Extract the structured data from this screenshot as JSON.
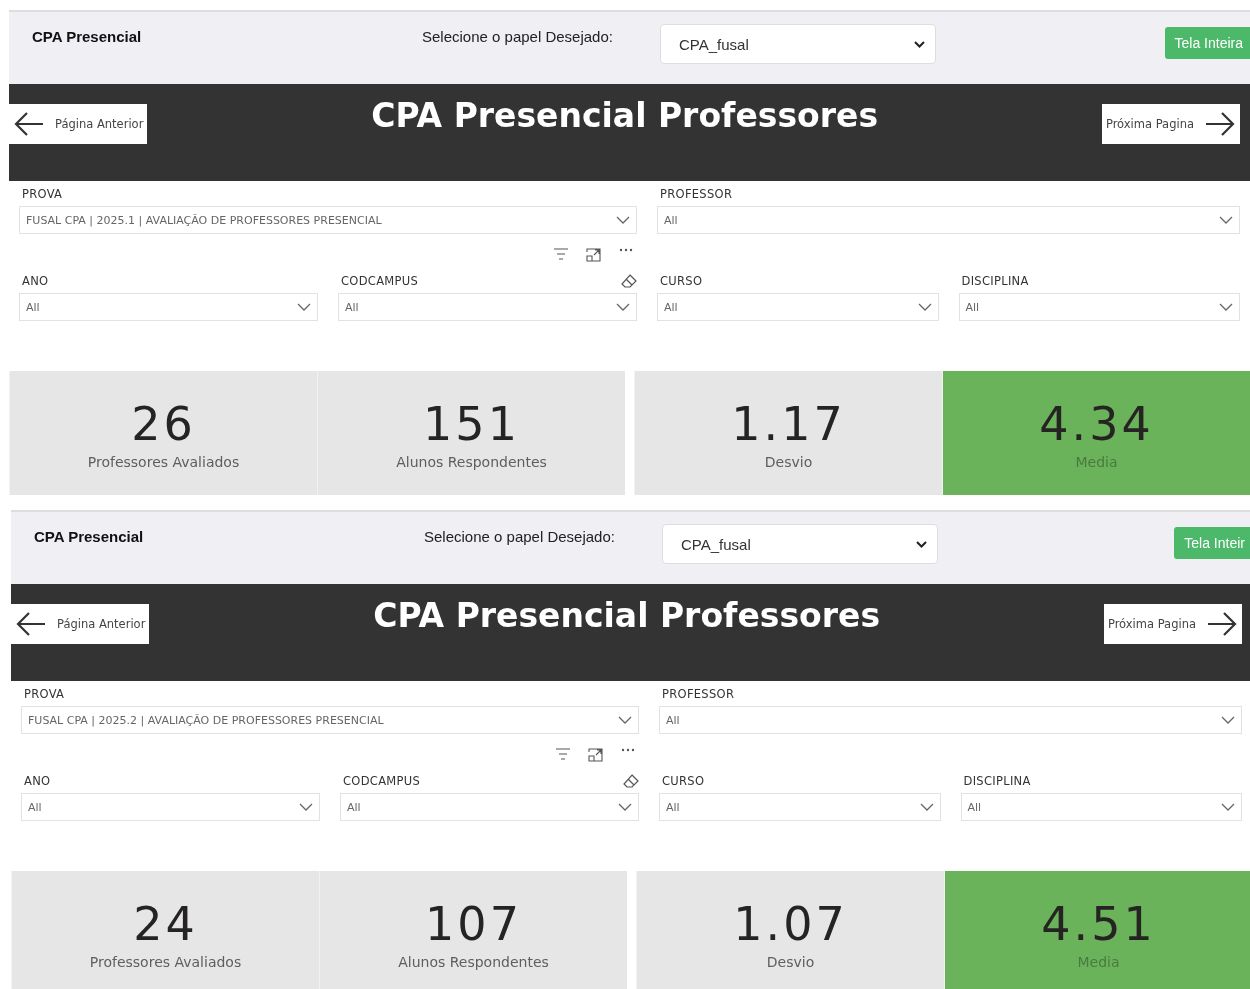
{
  "panels": [
    {
      "header": {
        "title": "CPA Presencial",
        "role_label": "Selecione o papel Desejado:",
        "role_value": "CPA_fusal",
        "fullscreen_button": "Tela Inteira"
      },
      "banner": {
        "title": "CPA Presencial Professores",
        "prev": "Página Anterior",
        "next": "Próxima Pagina"
      },
      "filters": {
        "prova": {
          "label": "PROVA",
          "value": "FUSAL CPA | 2025.1 | AVALIAÇÃO DE PROFESSORES PRESENCIAL"
        },
        "professor": {
          "label": "PROFESSOR",
          "value": "All"
        },
        "ano": {
          "label": "ANO",
          "value": "All"
        },
        "codcampus": {
          "label": "CODCAMPUS",
          "value": "All"
        },
        "curso": {
          "label": "CURSO",
          "value": "All"
        },
        "disciplina": {
          "label": "DISCIPLINA",
          "value": "All"
        }
      },
      "kpis": [
        {
          "value": "26",
          "label": "Professores Avaliados",
          "highlighted": false
        },
        {
          "value": "151",
          "label": "Alunos Respondentes",
          "highlighted": false
        },
        {
          "value": "1.17",
          "label": "Desvio",
          "highlighted": false
        },
        {
          "value": "4.34",
          "label": "Media",
          "highlighted": true
        }
      ]
    },
    {
      "header": {
        "title": "CPA Presencial",
        "role_label": "Selecione o papel Desejado:",
        "role_value": "CPA_fusal",
        "fullscreen_button": "Tela Inteir"
      },
      "banner": {
        "title": "CPA Presencial Professores",
        "prev": "Página Anterior",
        "next": "Próxima Pagina"
      },
      "filters": {
        "prova": {
          "label": "PROVA",
          "value": "FUSAL CPA | 2025.2 | AVALIAÇÃO DE PROFESSORES PRESENCIAL"
        },
        "professor": {
          "label": "PROFESSOR",
          "value": "All"
        },
        "ano": {
          "label": "ANO",
          "value": "All"
        },
        "codcampus": {
          "label": "CODCAMPUS",
          "value": "All"
        },
        "curso": {
          "label": "CURSO",
          "value": "All"
        },
        "disciplina": {
          "label": "DISCIPLINA",
          "value": "All"
        }
      },
      "kpis": [
        {
          "value": "24",
          "label": "Professores Avaliados",
          "highlighted": false
        },
        {
          "value": "107",
          "label": "Alunos Respondentes",
          "highlighted": false
        },
        {
          "value": "1.07",
          "label": "Desvio",
          "highlighted": false
        },
        {
          "value": "4.51",
          "label": "Media",
          "highlighted": true
        }
      ]
    }
  ]
}
